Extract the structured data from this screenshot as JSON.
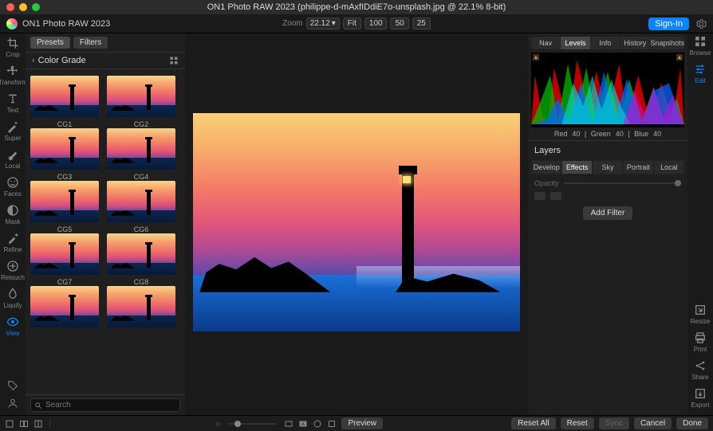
{
  "titlebar": {
    "title": "ON1 Photo RAW 2023 (philippe-d-mAxfIDdiE7o-unsplash.jpg @ 22.1% 8-bit)"
  },
  "appbar": {
    "app_name": "ON1 Photo RAW 2023",
    "zoom_label": "Zoom",
    "zoom_value": "22.12",
    "fit": "Fit",
    "z100": "100",
    "z50": "50",
    "z25": "25",
    "signin": "Sign-In"
  },
  "leftrail": {
    "items": [
      {
        "label": "Crop",
        "icon": "crop"
      },
      {
        "label": "Transform",
        "icon": "transform"
      },
      {
        "label": "Text",
        "icon": "text"
      },
      {
        "label": "Super",
        "icon": "wand"
      },
      {
        "label": "Local",
        "icon": "brush"
      },
      {
        "label": "Faces",
        "icon": "face"
      },
      {
        "label": "Mask",
        "icon": "mask"
      },
      {
        "label": "Refine",
        "icon": "refine"
      },
      {
        "label": "Retouch",
        "icon": "heal"
      },
      {
        "label": "Liquify",
        "icon": "liquify"
      },
      {
        "label": "View",
        "icon": "eye"
      }
    ]
  },
  "rightrail": {
    "top": [
      {
        "label": "Browse",
        "icon": "grid"
      },
      {
        "label": "Edit",
        "icon": "sliders"
      }
    ],
    "bottom": [
      {
        "label": "Resize",
        "icon": "resize"
      },
      {
        "label": "Print",
        "icon": "print"
      },
      {
        "label": "Share",
        "icon": "share"
      },
      {
        "label": "Export",
        "icon": "export"
      }
    ]
  },
  "presets": {
    "tabs": {
      "presets": "Presets",
      "filters": "Filters"
    },
    "section_title": "Color Grade",
    "items": [
      "CG1",
      "CG2",
      "CG3",
      "CG4",
      "CG5",
      "CG6",
      "CG7",
      "CG8"
    ],
    "search_placeholder": "Search"
  },
  "rightpanel": {
    "tabs": [
      "Nav",
      "Levels",
      "Info",
      "History",
      "Snapshots"
    ],
    "active_tab": 1,
    "rgb": {
      "r_label": "Red",
      "r": "40",
      "g_label": "Green",
      "g": "40",
      "b_label": "Blue",
      "b": "40"
    },
    "layers_title": "Layers",
    "ltabs": [
      "Develop",
      "Effects",
      "Sky",
      "Portrait",
      "Local"
    ],
    "ltab_active": 1,
    "opacity_label": "Opacity",
    "add_filter": "Add Filter"
  },
  "bottombar": {
    "preview": "Preview",
    "reset_all": "Reset All",
    "reset": "Reset",
    "sync": "Sync",
    "cancel": "Cancel",
    "done": "Done"
  }
}
